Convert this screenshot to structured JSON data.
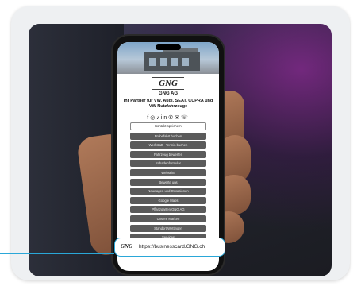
{
  "profile": {
    "logo": "GNG",
    "company": "GNG AG",
    "tagline": "Ihr Partner für VW, Audi, SEAT, CUPRA und VW Nutzfahrzeuge",
    "social_icons": [
      "facebook-icon",
      "instagram-icon",
      "tiktok-icon",
      "linkedin-icon",
      "whatsapp-icon",
      "mail-icon",
      "phone-icon"
    ],
    "social_glyphs": "f◎♪in✆✉☏"
  },
  "links": [
    "Kontakt speichern",
    "Probefahrt buchen",
    "Werkstatt - Termin buchen",
    "Fahrzeug bewerten",
    "Schadenformular",
    "Webseite",
    "Bewerte uns",
    "Neuwagen und Occasionen",
    "Google Maps",
    "Pflanzgarten GNG AG",
    "Unsere Marken",
    "Standort Wettingen",
    "Services"
  ],
  "url_bar": {
    "logo": "GNG",
    "url": "https://businesscard.GNG.ch"
  },
  "colors": {
    "accent": "#2aa7d8",
    "button": "#5b5b5b"
  }
}
